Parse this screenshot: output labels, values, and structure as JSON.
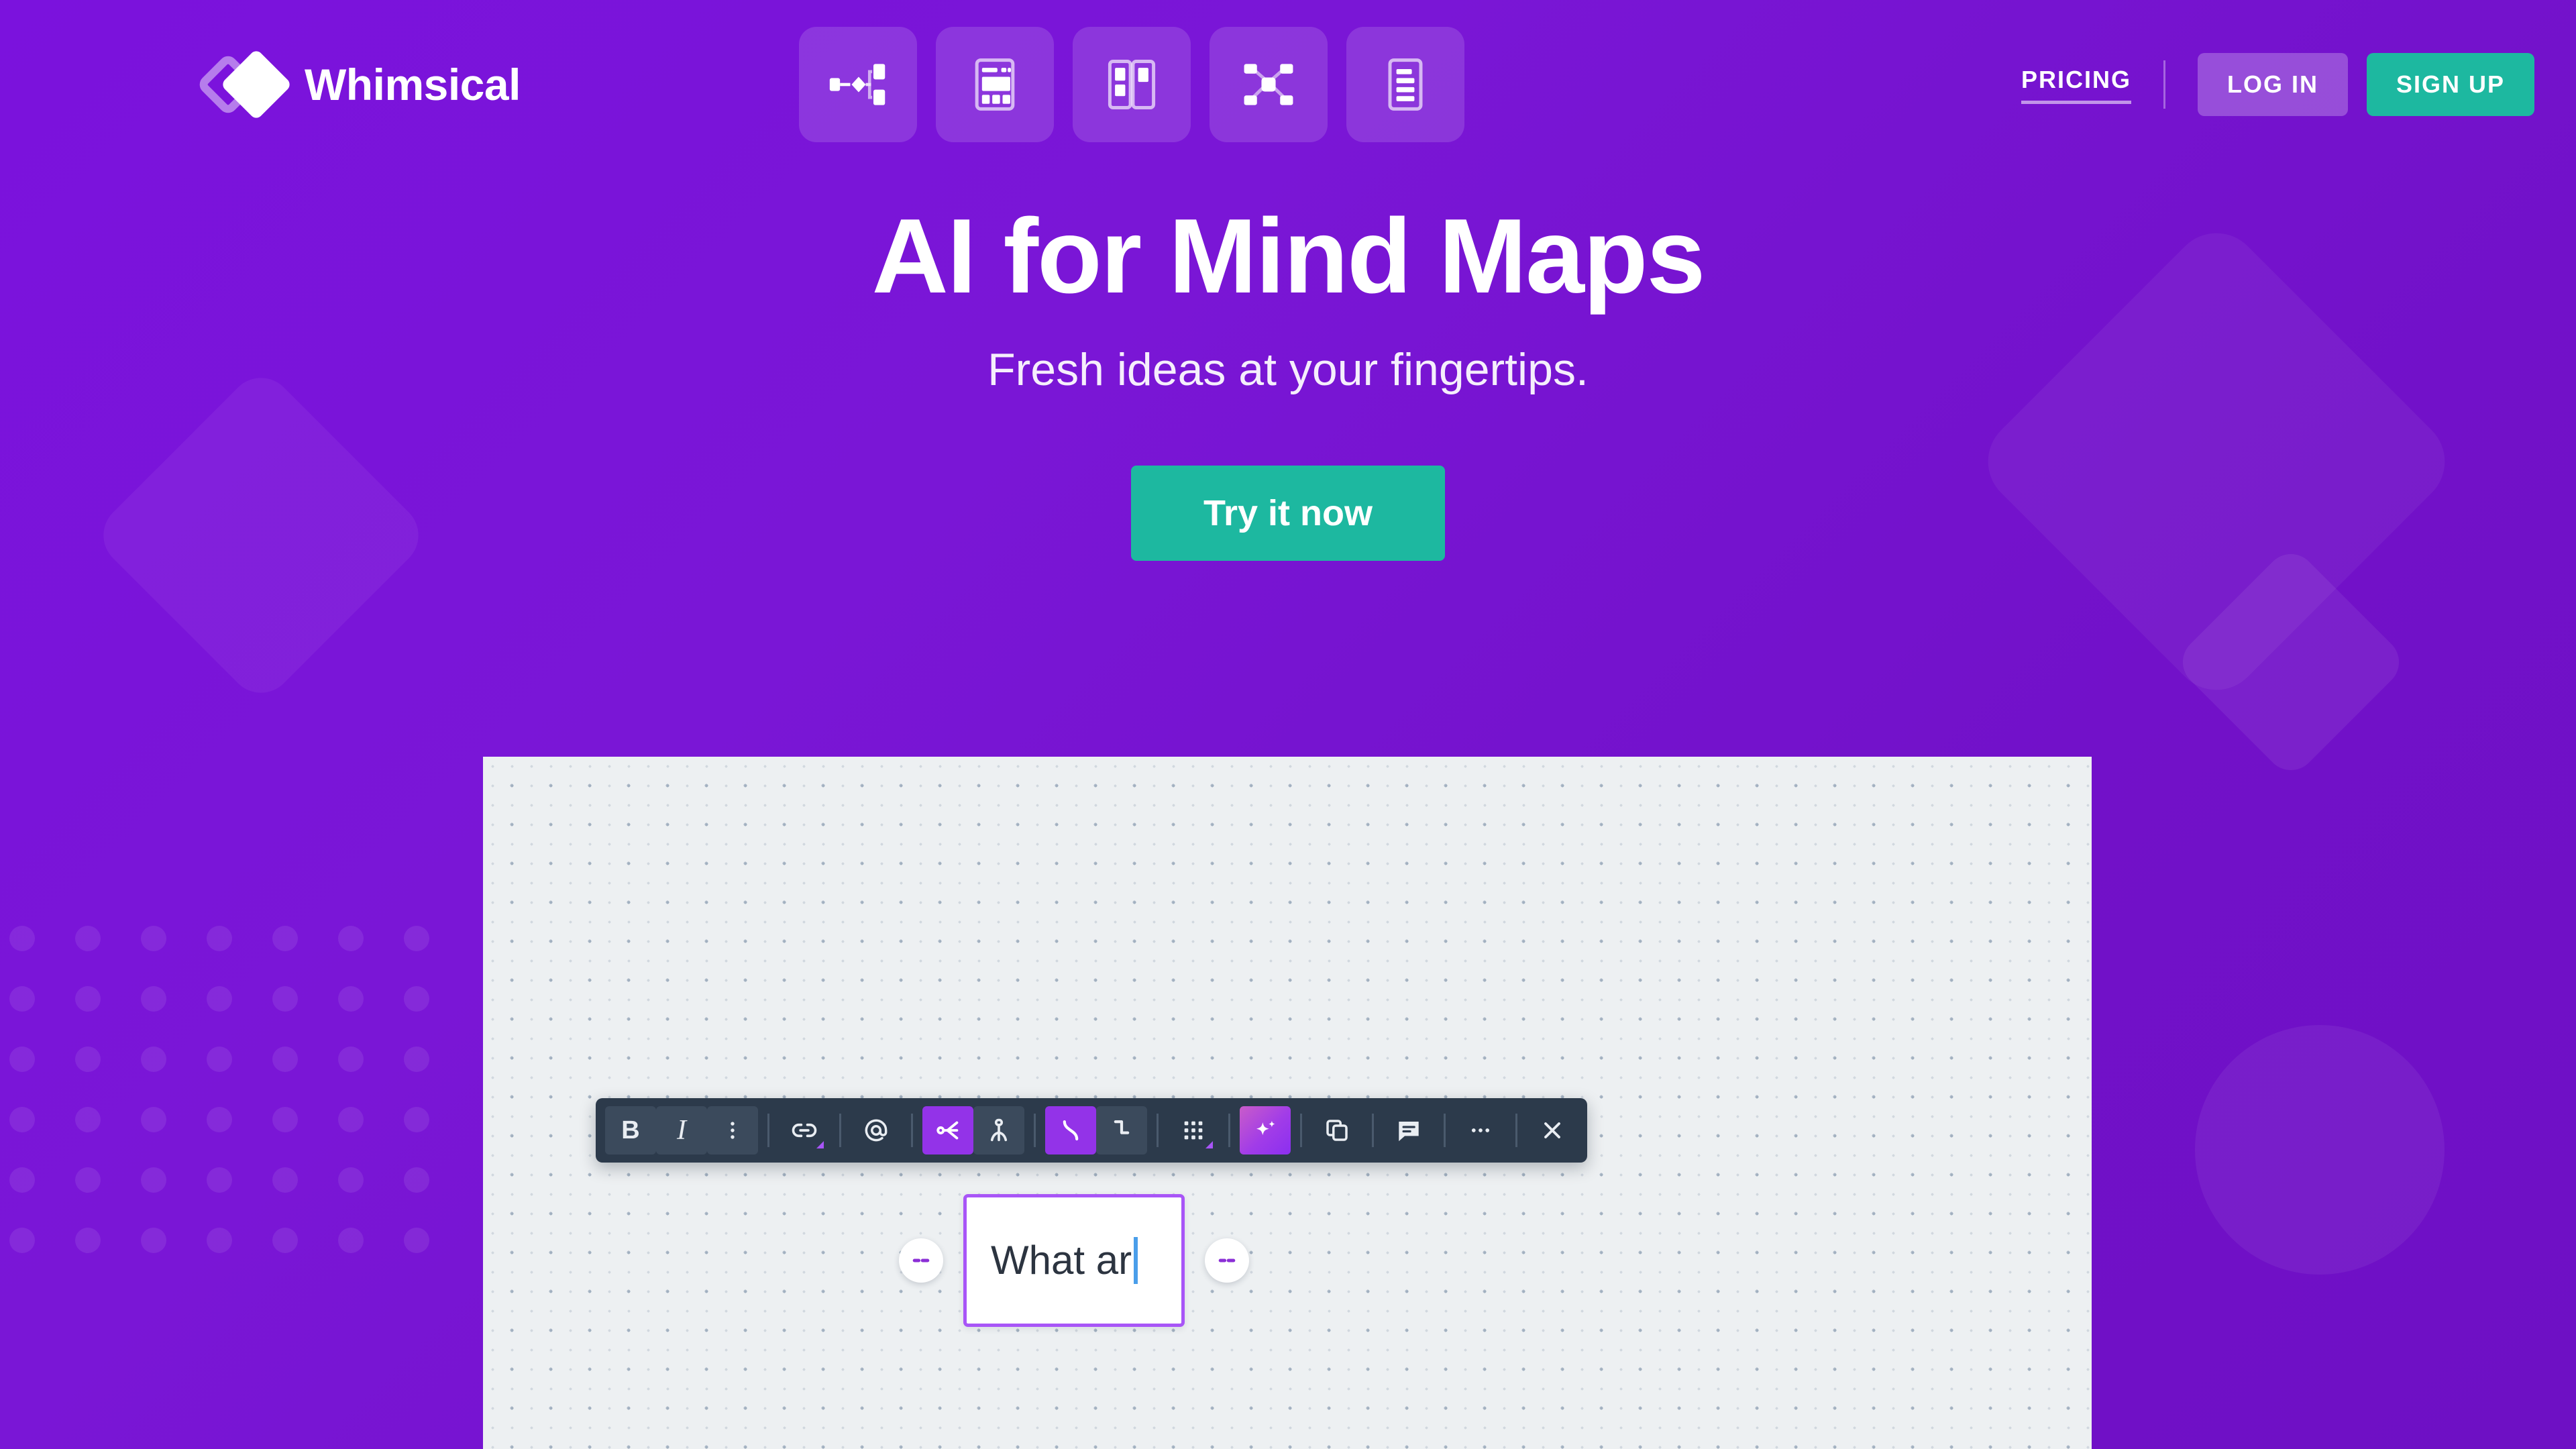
{
  "brand": {
    "name": "Whimsical",
    "logo_icon": "whimsical-diamond-logo"
  },
  "product_nav": [
    {
      "id": "flowcharts",
      "icon": "flowchart-icon",
      "label": "Flowcharts"
    },
    {
      "id": "wireframes",
      "icon": "wireframe-icon",
      "label": "Wireframes"
    },
    {
      "id": "boards",
      "icon": "sticky-notes-board-icon",
      "label": "Boards"
    },
    {
      "id": "mind-maps",
      "icon": "mind-map-icon",
      "label": "Mind Maps"
    },
    {
      "id": "docs",
      "icon": "docs-icon",
      "label": "Docs"
    }
  ],
  "header": {
    "pricing_label": "PRICING",
    "login_label": "LOG IN",
    "signup_label": "SIGN UP"
  },
  "hero": {
    "title": "AI for Mind Maps",
    "subtitle": "Fresh ideas at your fingertips.",
    "cta_label": "Try it now"
  },
  "toolbar": {
    "items": [
      {
        "id": "bold",
        "icon": "bold-icon",
        "glyph": "B",
        "state": "shade"
      },
      {
        "id": "italic",
        "icon": "italic-icon",
        "glyph": "I",
        "state": "shade"
      },
      {
        "id": "more-text",
        "icon": "vertical-dots-icon",
        "glyph": "",
        "state": "shade"
      },
      {
        "id": "link",
        "icon": "link-icon",
        "glyph": "",
        "state": "normal"
      },
      {
        "id": "mention",
        "icon": "at-mention-icon",
        "glyph": "",
        "state": "normal"
      },
      {
        "id": "branch",
        "icon": "branch-split-icon",
        "glyph": "",
        "state": "active"
      },
      {
        "id": "hierarchy",
        "icon": "person-hierarchy-icon",
        "glyph": "",
        "state": "shade"
      },
      {
        "id": "curved-line",
        "icon": "curved-connector-icon",
        "glyph": "",
        "state": "active"
      },
      {
        "id": "elbow-line",
        "icon": "elbow-connector-icon",
        "glyph": "",
        "state": "shade"
      },
      {
        "id": "color",
        "icon": "color-grid-icon",
        "glyph": "",
        "state": "normal"
      },
      {
        "id": "ai",
        "icon": "ai-sparkle-icon",
        "glyph": "",
        "state": "ai"
      },
      {
        "id": "duplicate",
        "icon": "duplicate-icon",
        "glyph": "",
        "state": "normal"
      },
      {
        "id": "comment",
        "icon": "comment-icon",
        "glyph": "",
        "state": "normal"
      },
      {
        "id": "more",
        "icon": "ellipsis-icon",
        "glyph": "",
        "state": "normal"
      },
      {
        "id": "close",
        "icon": "close-icon",
        "glyph": "",
        "state": "normal"
      }
    ]
  },
  "node": {
    "text": "What ar",
    "left_handle_icon": "add-sibling-left-icon",
    "right_handle_icon": "add-child-right-icon"
  },
  "colors": {
    "brand_purple": "#7513d1",
    "accent_teal": "#1db8a0",
    "node_border": "#a855f7",
    "toolbar_bg": "#2c3a4b",
    "toolbar_active": "#9333e8",
    "canvas_bg": "#edf0f2",
    "caret": "#4a9eea"
  }
}
